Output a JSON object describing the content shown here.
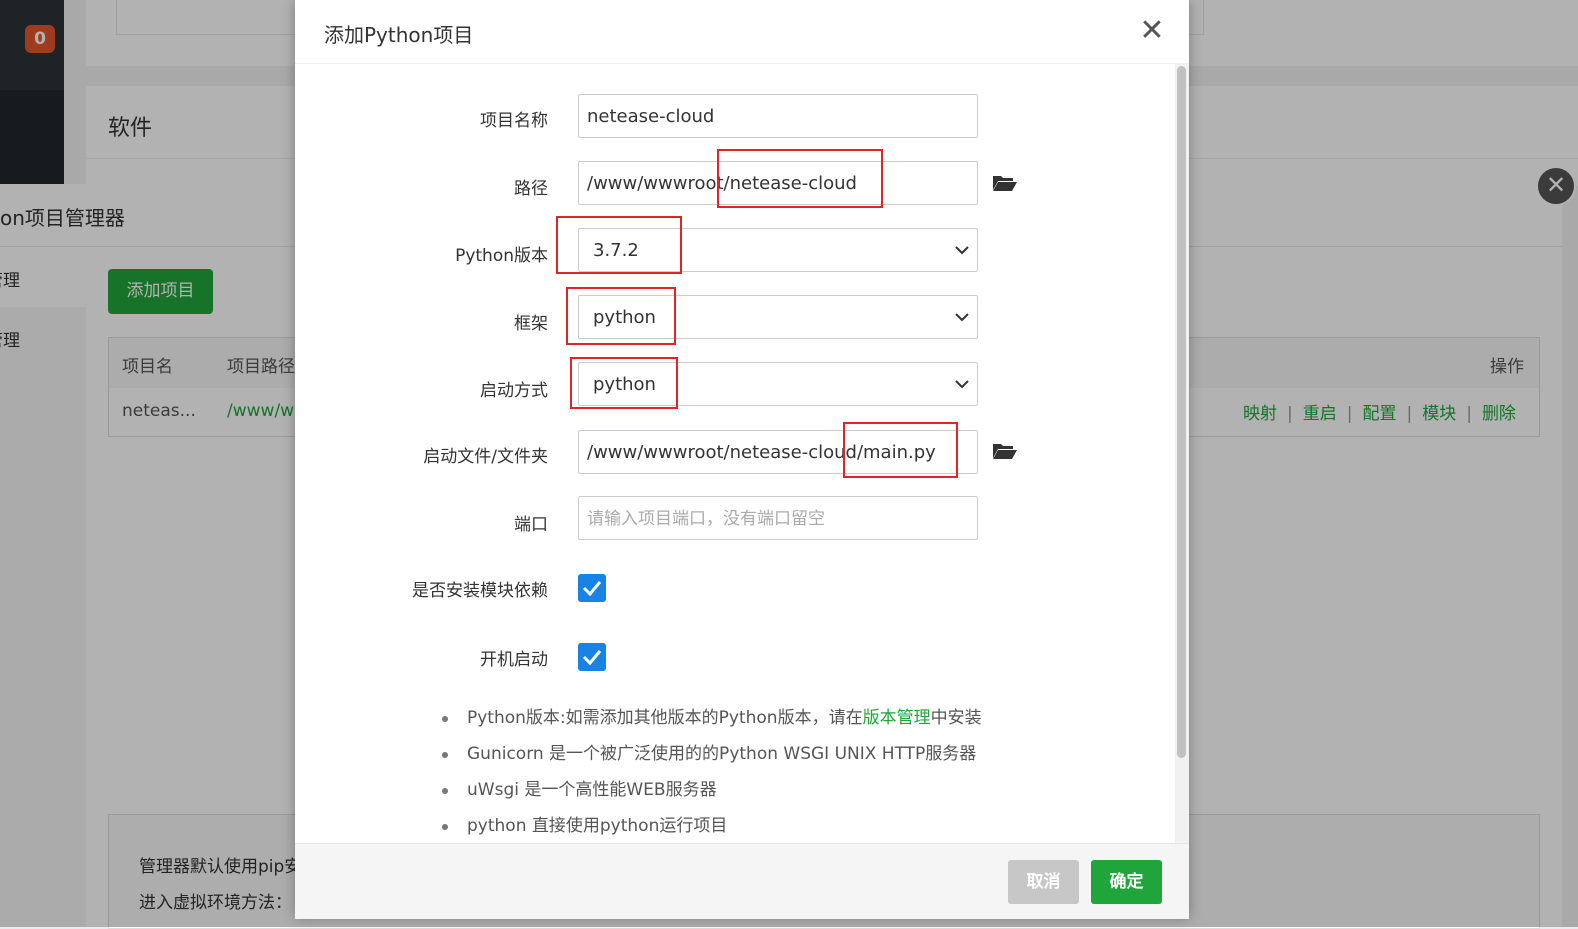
{
  "background": {
    "notification_count": "0",
    "software_section_title": "软件",
    "manager_title": "on项目管理器",
    "left_nav": [
      "管理",
      "管理"
    ],
    "add_project_button": "添加项目",
    "table": {
      "headers": [
        "项目名",
        "项目路径",
        "操作"
      ],
      "row": {
        "name": "neteas...",
        "path": "/www/w"
      },
      "actions": [
        "映射",
        "重启",
        "配置",
        "模块",
        "删除"
      ]
    },
    "info_lines": [
      "管理器默认使用pip安",
      "进入虚拟环境方法："
    ],
    "close_symbol": "✕"
  },
  "modal": {
    "title": "添加Python项目",
    "close_symbol": "✕",
    "fields": {
      "project_name": {
        "label": "项目名称",
        "value": "netease-cloud"
      },
      "path": {
        "label": "路径",
        "value": "/www/wwwroot/netease-cloud"
      },
      "python_version": {
        "label": "Python版本",
        "value": "3.7.2"
      },
      "framework": {
        "label": "框架",
        "value": "python"
      },
      "start_method": {
        "label": "启动方式",
        "value": "python"
      },
      "start_file": {
        "label": "启动文件/文件夹",
        "value": "/www/wwwroot/netease-cloud/main.py"
      },
      "port": {
        "label": "端口",
        "placeholder": "请输入项目端口，没有端口留空"
      },
      "install_deps": {
        "label": "是否安装模块依赖",
        "checked": true
      },
      "autostart": {
        "label": "开机启动",
        "checked": true
      }
    },
    "tips": {
      "tip1_prefix": "Python版本:如需添加其他版本的Python版本，请在",
      "tip1_link": "版本管理",
      "tip1_suffix": "中安装",
      "tip2": "Gunicorn 是一个被广泛使用的的Python WSGI UNIX HTTP服务器",
      "tip3": "uWsgi 是一个高性能WEB服务器",
      "tip4": "python 直接使用python运行项目"
    },
    "buttons": {
      "cancel": "取消",
      "confirm": "确定"
    }
  },
  "colors": {
    "accent_green": "#20a53a",
    "checkbox_blue": "#1783e6",
    "highlight_red": "#e0252a",
    "badge_orange": "#e4572e"
  }
}
